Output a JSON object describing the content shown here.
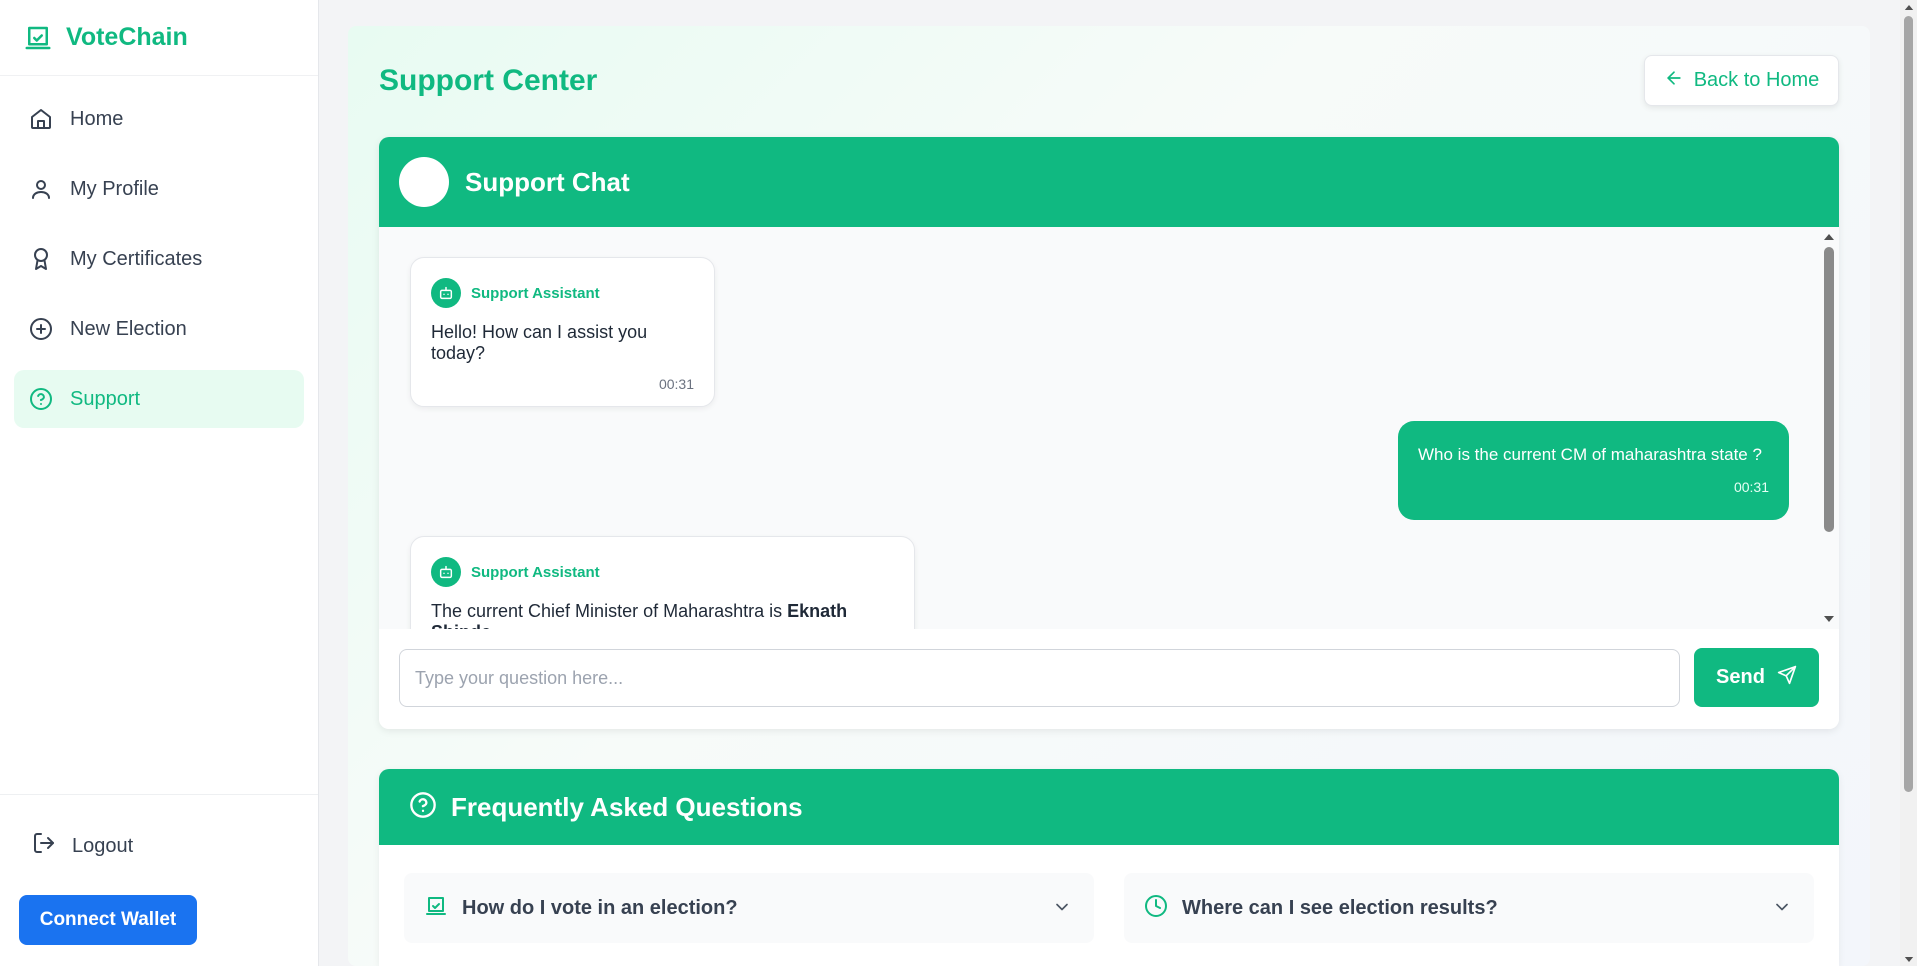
{
  "brand": {
    "name": "VoteChain",
    "icon": "ballot-box-icon"
  },
  "sidebar": {
    "items": [
      {
        "label": "Home",
        "icon": "home-icon"
      },
      {
        "label": "My Profile",
        "icon": "user-icon"
      },
      {
        "label": "My Certificates",
        "icon": "award-icon"
      },
      {
        "label": "New Election",
        "icon": "plus-circle-icon"
      },
      {
        "label": "Support",
        "icon": "help-circle-icon",
        "active": true
      }
    ],
    "logout_label": "Logout",
    "wallet_label": "Connect Wallet"
  },
  "header": {
    "title": "Support Center",
    "back_label": "Back to Home"
  },
  "chat": {
    "title": "Support Chat",
    "messages": [
      {
        "from": "bot",
        "sender": "Support Assistant",
        "text": "Hello! How can I assist you today?",
        "time": "00:31"
      },
      {
        "from": "user",
        "text": "Who is the current CM of maharashtra state ?",
        "time": "00:31"
      },
      {
        "from": "bot",
        "sender": "Support Assistant",
        "text_before": "The current Chief Minister of Maharashtra is ",
        "text_bold": "Eknath Shinde",
        "text_after": "."
      }
    ],
    "input_placeholder": "Type your question here...",
    "send_label": "Send"
  },
  "faq": {
    "title": "Frequently Asked Questions",
    "items": [
      {
        "question": "How do I vote in an election?",
        "icon": "ballot-box-icon"
      },
      {
        "question": "Where can I see election results?",
        "icon": "clock-icon"
      }
    ]
  },
  "colors": {
    "accent": "#10b981",
    "wallet": "#1a73f0",
    "active_bg": "#e7fbf1"
  }
}
